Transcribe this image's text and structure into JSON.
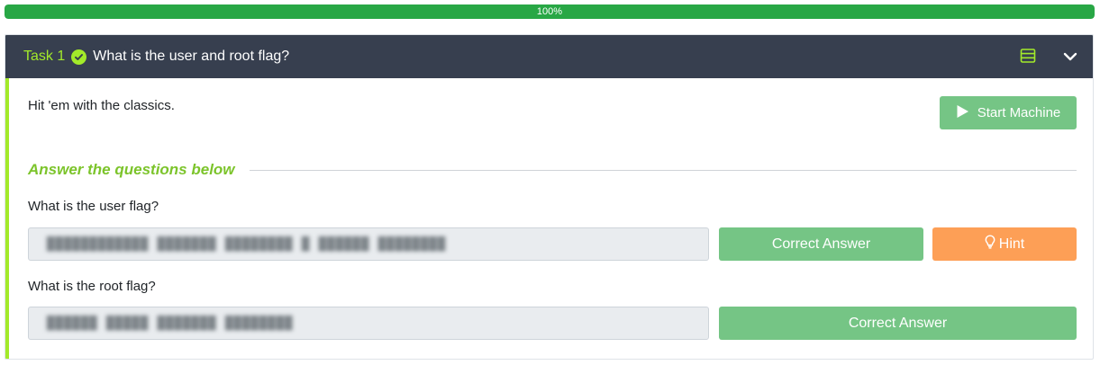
{
  "progress": {
    "percent": 1.0,
    "label": "100%",
    "color": "#28a745"
  },
  "task": {
    "number_label": "Task 1",
    "title": "What is the user and root flag?",
    "completed": true,
    "header_bg": "#373f4f",
    "accent": "#a3ea2a"
  },
  "body": {
    "description": "Hit 'em with the classics.",
    "start_machine_label": "Start Machine",
    "section_title": "Answer the questions below"
  },
  "questions": [
    {
      "label": "What is the user flag?",
      "answer_blurred": "████████████ ███████ ████████ █ ██████ ████████",
      "submit_label": "Correct Answer",
      "hint_label": "Hint"
    },
    {
      "label": "What is the root flag?",
      "answer_blurred": "██████ █████ ███████ ████████",
      "submit_label": "Correct Answer"
    }
  ],
  "colors": {
    "success": "#75c585",
    "hint": "#fd9f56"
  }
}
